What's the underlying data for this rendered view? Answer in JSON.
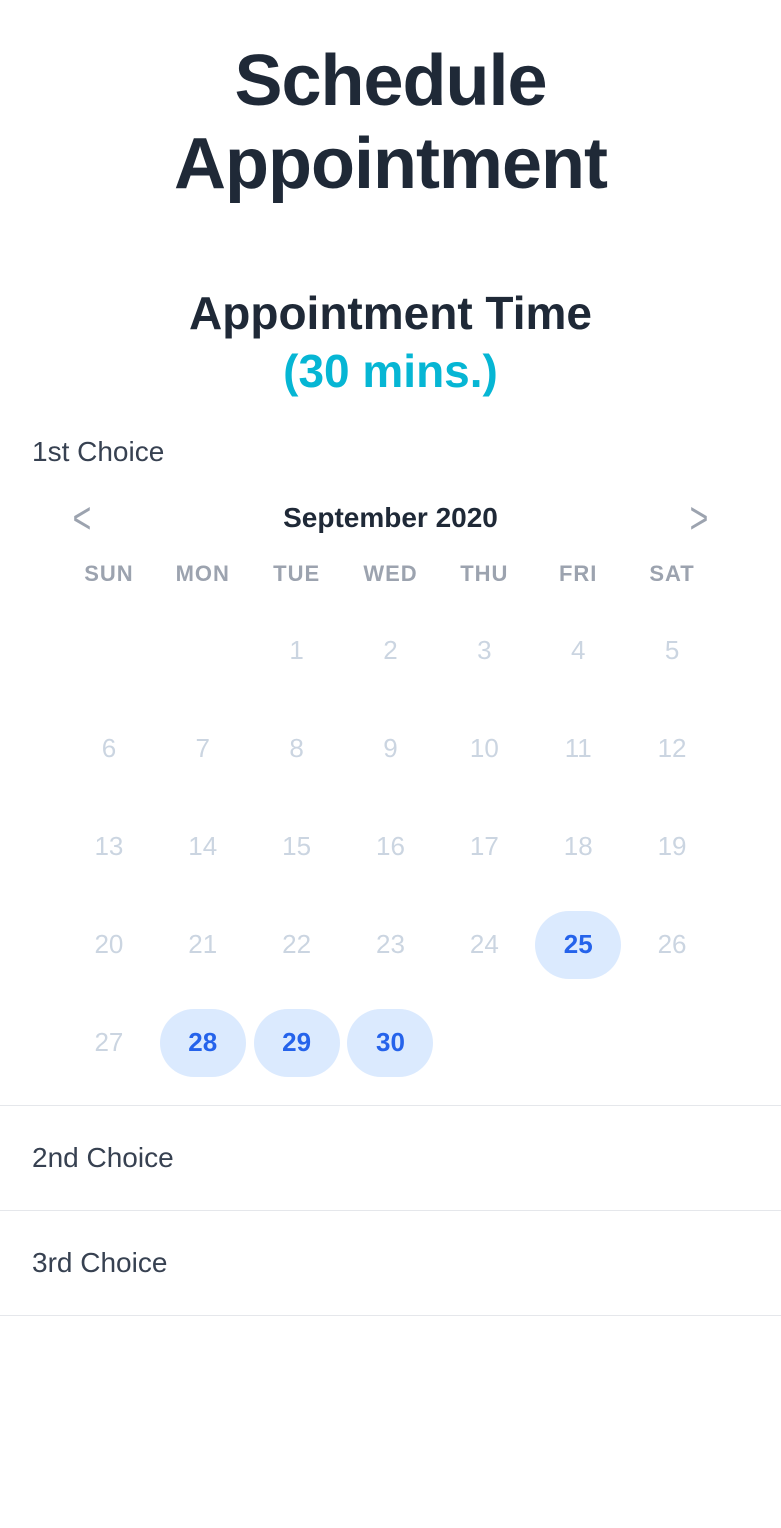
{
  "header": {
    "title": "Schedule Appointment"
  },
  "section": {
    "title": "Appointment Time",
    "duration": "(30 mins.)"
  },
  "calendar": {
    "choice_label": "1st Choice",
    "prev": "<",
    "next": ">",
    "month_year": "September  2020",
    "dow": [
      "SUN",
      "MON",
      "TUE",
      "WED",
      "THU",
      "FRI",
      "SAT"
    ],
    "weeks": [
      [
        {
          "n": "",
          "state": "empty"
        },
        {
          "n": "",
          "state": "empty"
        },
        {
          "n": "1",
          "state": "disabled"
        },
        {
          "n": "2",
          "state": "disabled"
        },
        {
          "n": "3",
          "state": "disabled"
        },
        {
          "n": "4",
          "state": "disabled"
        },
        {
          "n": "5",
          "state": "disabled"
        }
      ],
      [
        {
          "n": "6",
          "state": "disabled"
        },
        {
          "n": "7",
          "state": "disabled"
        },
        {
          "n": "8",
          "state": "disabled"
        },
        {
          "n": "9",
          "state": "disabled"
        },
        {
          "n": "10",
          "state": "disabled"
        },
        {
          "n": "11",
          "state": "disabled"
        },
        {
          "n": "12",
          "state": "disabled"
        }
      ],
      [
        {
          "n": "13",
          "state": "disabled"
        },
        {
          "n": "14",
          "state": "disabled"
        },
        {
          "n": "15",
          "state": "disabled"
        },
        {
          "n": "16",
          "state": "disabled"
        },
        {
          "n": "17",
          "state": "disabled"
        },
        {
          "n": "18",
          "state": "disabled"
        },
        {
          "n": "19",
          "state": "disabled"
        }
      ],
      [
        {
          "n": "20",
          "state": "disabled"
        },
        {
          "n": "21",
          "state": "disabled"
        },
        {
          "n": "22",
          "state": "disabled"
        },
        {
          "n": "23",
          "state": "disabled"
        },
        {
          "n": "24",
          "state": "disabled"
        },
        {
          "n": "25",
          "state": "available"
        },
        {
          "n": "26",
          "state": "disabled"
        }
      ],
      [
        {
          "n": "27",
          "state": "disabled"
        },
        {
          "n": "28",
          "state": "available"
        },
        {
          "n": "29",
          "state": "available"
        },
        {
          "n": "30",
          "state": "available"
        },
        {
          "n": "",
          "state": "empty"
        },
        {
          "n": "",
          "state": "empty"
        },
        {
          "n": "",
          "state": "empty"
        }
      ]
    ]
  },
  "choices": {
    "second": "2nd Choice",
    "third": "3rd Choice"
  }
}
